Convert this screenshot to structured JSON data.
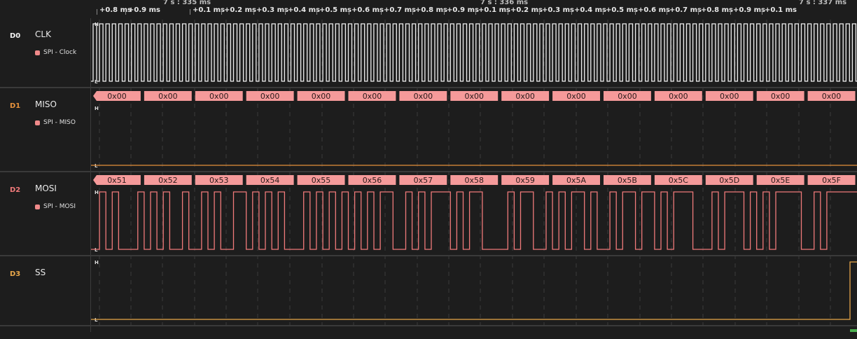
{
  "ruler": {
    "major": [
      {
        "label": "7 s : 335 ms",
        "pos": 0
      },
      {
        "label": "7 s : 336 ms",
        "pos": 1
      },
      {
        "label": "7 s : 337 ms",
        "pos": 2
      }
    ],
    "ticks": [
      "+0.8 ms",
      "+0.9 ms",
      "+0.1 ms",
      "+0.2 ms",
      "+0.3 ms",
      "+0.4 ms",
      "+0.5 ms",
      "+0.6 ms",
      "+0.7 ms",
      "+0.8 ms",
      "+0.9 ms",
      "+0.1 ms",
      "+0.2 ms",
      "+0.3 ms",
      "+0.4 ms",
      "+0.5 ms",
      "+0.6 ms",
      "+0.7 ms",
      "+0.8 ms",
      "+0.9 ms",
      "+0.1 ms"
    ]
  },
  "channels": [
    {
      "id": "D0",
      "name": "CLK",
      "color": "#f5f5f5",
      "analyzer": "SPI - Clock",
      "signal": "clock"
    },
    {
      "id": "D1",
      "name": "MISO",
      "color": "#e6913b",
      "analyzer": "SPI - MISO",
      "signal": "low",
      "bytes": [
        "0x00",
        "0x00",
        "0x00",
        "0x00",
        "0x00",
        "0x00",
        "0x00",
        "0x00",
        "0x00",
        "0x00",
        "0x00",
        "0x00",
        "0x00",
        "0x00",
        "0x00"
      ]
    },
    {
      "id": "D2",
      "name": "MOSI",
      "color": "#f07a7a",
      "analyzer": "SPI - MOSI",
      "signal": "data",
      "bytes": [
        "0x51",
        "0x52",
        "0x53",
        "0x54",
        "0x55",
        "0x56",
        "0x57",
        "0x58",
        "0x59",
        "0x5A",
        "0x5B",
        "0x5C",
        "0x5D",
        "0x5E",
        "0x5F"
      ]
    },
    {
      "id": "D3",
      "name": "SS",
      "color": "#e8a74a",
      "analyzer": "",
      "signal": "select"
    }
  ],
  "level_labels": {
    "high": "H",
    "low": "L"
  },
  "colors": {
    "trace": "#f0f0f0",
    "decode_box": "#f59a9a",
    "decode_text": "#2a1a1a",
    "grid": "#3a3a3a"
  }
}
